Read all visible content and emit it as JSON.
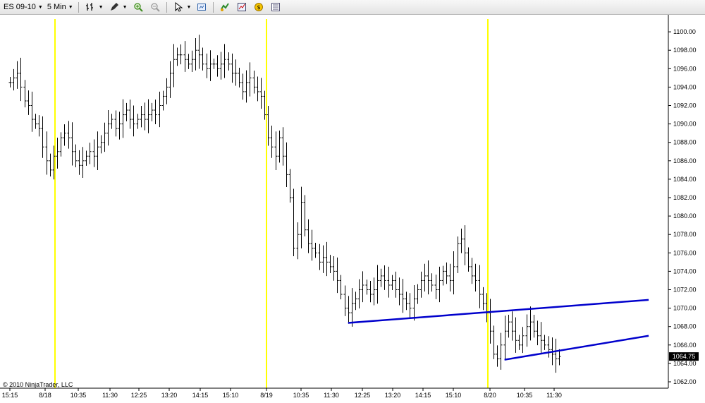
{
  "toolbar": {
    "instrument": "ES 09-10",
    "interval": "5 Min"
  },
  "copyright": "© 2010 NinjaTrader, LLC",
  "chart_data": {
    "type": "bar",
    "subtype": "ohlc",
    "title": "",
    "ylim": [
      1061.5,
      1101
    ],
    "grid": false,
    "price_ticks": [
      "1062.00",
      "1064.00",
      "1066.00",
      "1068.00",
      "1070.00",
      "1072.00",
      "1074.00",
      "1076.00",
      "1078.00",
      "1080.00",
      "1082.00",
      "1084.00",
      "1086.00",
      "1088.00",
      "1090.00",
      "1092.00",
      "1094.00",
      "1096.00",
      "1098.00",
      "1100.00"
    ],
    "time_labels": [
      "15:15",
      "8/18",
      "10:35",
      "11:30",
      "12:25",
      "13:20",
      "14:15",
      "15:10",
      "8/19",
      "10:35",
      "11:30",
      "12:25",
      "13:20",
      "14:15",
      "15:10",
      "8/20",
      "10:35",
      "11:30"
    ],
    "last_price": "1064.75",
    "session_breaks": [
      "8/18",
      "8/19",
      "8/20"
    ],
    "colors": {
      "bars": "#000000",
      "session_line": "#ffff00",
      "trendline": "#0000cc",
      "last_price_box": "#000000"
    },
    "trendlines": [
      {
        "x1": 93,
        "y1": 1068.4,
        "x2": 164,
        "y2": 1070.9
      },
      {
        "x1": 136,
        "y1": 1064.4,
        "x2": 164,
        "y2": 1067.0
      }
    ],
    "closes": [
      1094.5,
      1095.0,
      1095.5,
      1094.0,
      1092.5,
      1092.0,
      1090.5,
      1090.0,
      1089.5,
      1087.5,
      1086.0,
      1085.0,
      1086.5,
      1087.0,
      1088.5,
      1089.0,
      1088.5,
      1087.0,
      1086.0,
      1085.5,
      1086.0,
      1086.5,
      1087.0,
      1086.5,
      1087.5,
      1088.0,
      1089.0,
      1090.0,
      1090.5,
      1089.5,
      1090.0,
      1091.0,
      1091.5,
      1090.5,
      1090.0,
      1090.5,
      1091.0,
      1090.5,
      1091.0,
      1091.5,
      1091.0,
      1092.0,
      1093.0,
      1094.0,
      1095.5,
      1097.0,
      1097.5,
      1097.5,
      1097.0,
      1096.5,
      1097.0,
      1098.0,
      1097.5,
      1096.5,
      1096.0,
      1096.5,
      1096.5,
      1096.0,
      1096.5,
      1097.0,
      1096.5,
      1095.5,
      1095.5,
      1094.5,
      1093.5,
      1094.5,
      1095.0,
      1094.0,
      1093.5,
      1093.0,
      1091.0,
      1088.5,
      1087.5,
      1086.5,
      1088.5,
      1086.5,
      1084.5,
      1082.0,
      1076.5,
      1078.0,
      1081.5,
      1078.5,
      1077.0,
      1076.5,
      1076.0,
      1075.0,
      1075.5,
      1075.0,
      1074.5,
      1074.0,
      1073.0,
      1071.5,
      1070.0,
      1069.5,
      1070.5,
      1071.0,
      1072.0,
      1072.5,
      1072.0,
      1071.5,
      1072.0,
      1073.0,
      1073.5,
      1073.0,
      1072.5,
      1073.0,
      1072.0,
      1071.5,
      1071.0,
      1070.5,
      1070.0,
      1071.0,
      1072.0,
      1073.0,
      1073.5,
      1073.0,
      1072.5,
      1072.0,
      1073.0,
      1074.0,
      1073.5,
      1073.0,
      1074.5,
      1077.0,
      1077.5,
      1076.0,
      1074.5,
      1073.5,
      1073.0,
      1071.5,
      1070.5,
      1069.5,
      1067.5,
      1065.0,
      1064.5,
      1066.0,
      1067.5,
      1068.5,
      1067.5,
      1066.5,
      1066.0,
      1067.0,
      1068.0,
      1068.5,
      1067.5,
      1067.0,
      1066.5,
      1066.0,
      1065.5,
      1065.0,
      1064.5,
      1064.75
    ]
  }
}
